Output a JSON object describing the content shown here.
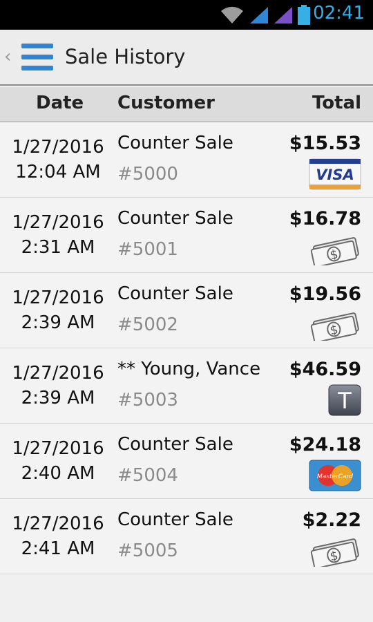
{
  "status_bar": {
    "time": "02:41"
  },
  "action_bar": {
    "back_glyph": "‹",
    "title": "Sale History"
  },
  "columns": {
    "date": "Date",
    "customer": "Customer",
    "total": "Total"
  },
  "sales": [
    {
      "date": "1/27/2016",
      "time": "12:04 AM",
      "customer": "Counter Sale",
      "order": "#5000",
      "total": "$15.53",
      "payment": "visa-card"
    },
    {
      "date": "1/27/2016",
      "time": "2:31 AM",
      "customer": "Counter Sale",
      "order": "#5001",
      "total": "$16.78",
      "payment": "cash"
    },
    {
      "date": "1/27/2016",
      "time": "2:39 AM",
      "customer": "Counter Sale",
      "order": "#5002",
      "total": "$19.56",
      "payment": "cash"
    },
    {
      "date": "1/27/2016",
      "time": "2:39 AM",
      "customer": "** Young, Vance",
      "order": "#5003",
      "total": "$46.59",
      "payment": "tab"
    },
    {
      "date": "1/27/2016",
      "time": "2:40 AM",
      "customer": "Counter Sale",
      "order": "#5004",
      "total": "$24.18",
      "payment": "mastercard"
    },
    {
      "date": "1/27/2016",
      "time": "2:41 AM",
      "customer": "Counter Sale",
      "order": "#5005",
      "total": "$2.22",
      "payment": "cash"
    }
  ],
  "payment_icons": {
    "visa_text": "VISA",
    "mastercard_text": "MasterCard",
    "tab_letter": "T",
    "cash_symbol": "$"
  }
}
